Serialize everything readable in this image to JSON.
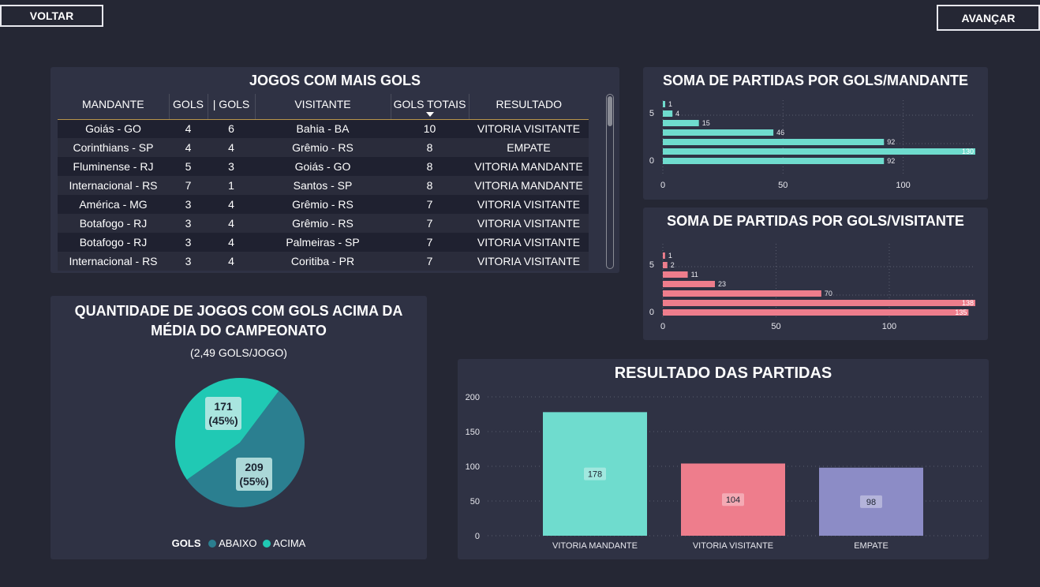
{
  "nav": {
    "back_label": "VOLTAR",
    "next_label": "AVANÇAR"
  },
  "colors": {
    "background": "#252734",
    "panel": "#2f3244",
    "mandante": "#6fdcce",
    "visitante": "#ee7d8c",
    "empate": "#8c8cc6",
    "abaixo": "#2b7f90",
    "acima": "#20c9b4"
  },
  "table": {
    "title": "JOGOS COM MAIS GOLS",
    "headers": [
      "MANDANTE",
      "GOLS",
      "| GOLS",
      "VISITANTE",
      "GOLS TOTAIS",
      "RESULTADO"
    ],
    "rows": [
      [
        "Goiás - GO",
        "4",
        "6",
        "Bahia - BA",
        "10",
        "VITORIA VISITANTE"
      ],
      [
        "Corinthians - SP",
        "4",
        "4",
        "Grêmio - RS",
        "8",
        "EMPATE"
      ],
      [
        "Fluminense - RJ",
        "5",
        "3",
        "Goiás - GO",
        "8",
        "VITORIA MANDANTE"
      ],
      [
        "Internacional - RS",
        "7",
        "1",
        "Santos - SP",
        "8",
        "VITORIA MANDANTE"
      ],
      [
        "América - MG",
        "3",
        "4",
        "Grêmio - RS",
        "7",
        "VITORIA VISITANTE"
      ],
      [
        "Botafogo - RJ",
        "3",
        "4",
        "Grêmio - RS",
        "7",
        "VITORIA VISITANTE"
      ],
      [
        "Botafogo - RJ",
        "3",
        "4",
        "Palmeiras - SP",
        "7",
        "VITORIA VISITANTE"
      ],
      [
        "Internacional - RS",
        "3",
        "4",
        "Coritiba - PR",
        "7",
        "VITORIA VISITANTE"
      ]
    ]
  },
  "chart_data": [
    {
      "type": "pie",
      "title": "QUANTIDADE DE JOGOS COM GOLS ACIMA DA MÉDIA DO CAMPEONATO",
      "subtitle": "(2,49 GOLS/JOGO)",
      "legend_title": "GOLS",
      "labels": [
        "ABAIXO",
        "ACIMA"
      ],
      "values": [
        209,
        171
      ],
      "percent_labels": [
        "(55%)",
        "(45%)"
      ],
      "legend": "bottom"
    },
    {
      "type": "bar",
      "orientation": "horizontal",
      "title": "SOMA DE PARTIDAS POR GOLS/MANDANTE",
      "categories": [
        0,
        1,
        2,
        3,
        4,
        5,
        6
      ],
      "values": [
        92,
        130,
        92,
        46,
        15,
        4,
        1
      ],
      "y_tick_labels": [
        "0",
        "5"
      ],
      "xlim": [
        0,
        130
      ],
      "x_ticks": [
        0,
        50,
        100
      ],
      "grid": true
    },
    {
      "type": "bar",
      "orientation": "horizontal",
      "title": "SOMA DE PARTIDAS POR GOLS/VISITANTE",
      "categories": [
        0,
        1,
        2,
        3,
        4,
        5,
        6
      ],
      "values": [
        135,
        138,
        70,
        23,
        11,
        2,
        1
      ],
      "y_tick_labels": [
        "0",
        "5"
      ],
      "xlim": [
        0,
        138
      ],
      "x_ticks": [
        0,
        50,
        100
      ],
      "grid": true
    },
    {
      "type": "bar",
      "title": "RESULTADO DAS PARTIDAS",
      "categories": [
        "VITORIA MANDANTE",
        "VITORIA VISITANTE",
        "EMPATE"
      ],
      "values": [
        178,
        104,
        98
      ],
      "ylim": [
        0,
        200
      ],
      "y_ticks": [
        0,
        50,
        100,
        150,
        200
      ],
      "grid": true
    }
  ]
}
